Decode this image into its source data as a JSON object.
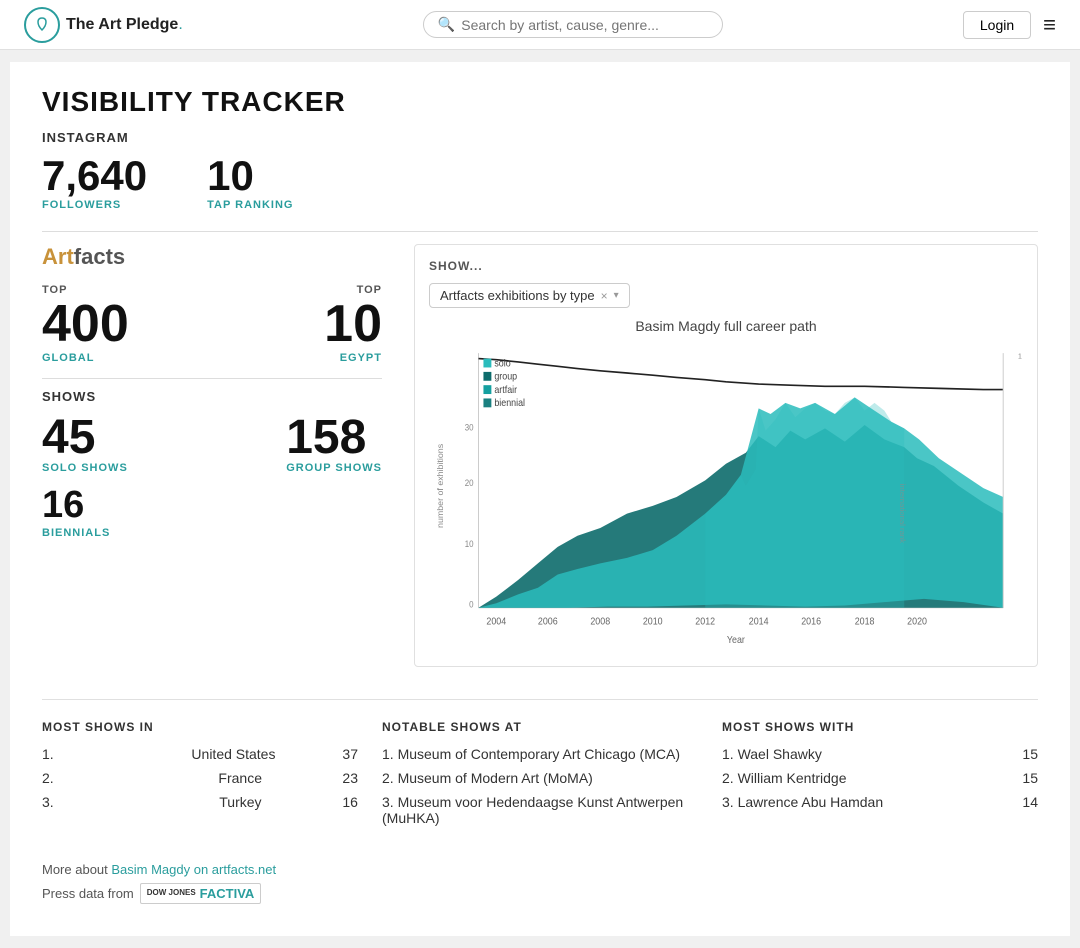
{
  "header": {
    "logo_text": "The Art Pledge",
    "logo_dot": ".",
    "search_placeholder": "Search by artist, cause, genre...",
    "login_label": "Login",
    "menu_icon": "≡"
  },
  "page": {
    "title": "VISIBILITY TRACKER"
  },
  "instagram": {
    "section_label": "INSTAGRAM",
    "followers_value": "7,640",
    "followers_label": "FOLLOWERS",
    "tap_ranking_value": "10",
    "tap_ranking_label": "TAP RANKING"
  },
  "artfacts": {
    "logo_art": "Art",
    "logo_facts": "facts",
    "top_label_left": "TOP",
    "top_label_right": "TOP",
    "rank_left": "400",
    "rank_left_label": "GLOBAL",
    "rank_right": "10",
    "rank_right_label": "EGYPT",
    "shows_header": "SHOWS",
    "solo_shows_value": "45",
    "solo_shows_label": "SOLO SHOWS",
    "group_shows_value": "158",
    "group_shows_label": "GROUP SHOWS",
    "biennials_value": "16",
    "biennials_label": "BIENNIALS"
  },
  "chart": {
    "show_label": "SHOW...",
    "dropdown_value": "Artfacts exhibitions by type",
    "title": "Basim Magdy full career path",
    "legend": [
      "solo",
      "group",
      "artfair",
      "biennial"
    ],
    "colors": [
      "#2abcbc",
      "#1a8080",
      "#15a0a0",
      "#0d6060"
    ],
    "x_axis_label": "Year",
    "years": [
      "2004",
      "2006",
      "2008",
      "2010",
      "2012",
      "2014",
      "2016",
      "2018",
      "2020"
    ]
  },
  "most_shows_in": {
    "title": "MOST SHOWS IN",
    "items": [
      {
        "rank": "1.",
        "name": "United States",
        "count": "37"
      },
      {
        "rank": "2.",
        "name": "France",
        "count": "23"
      },
      {
        "rank": "3.",
        "name": "Turkey",
        "count": "16"
      }
    ]
  },
  "notable_shows_at": {
    "title": "NOTABLE SHOWS AT",
    "items": [
      {
        "rank": "1.",
        "name": "Museum of Contemporary Art Chicago (MCA)",
        "count": ""
      },
      {
        "rank": "2.",
        "name": "Museum of Modern Art (MoMA)",
        "count": ""
      },
      {
        "rank": "3.",
        "name": "Museum voor Hedendaagse Kunst Antwerpen (MuHKA)",
        "count": ""
      }
    ]
  },
  "most_shows_with": {
    "title": "MOST SHOWS WITH",
    "items": [
      {
        "rank": "1.",
        "name": "Wael Shawky",
        "count": "15"
      },
      {
        "rank": "2.",
        "name": "William Kentridge",
        "count": "15"
      },
      {
        "rank": "3.",
        "name": "Lawrence Abu Hamdan",
        "count": "14"
      }
    ]
  },
  "footer": {
    "more_about_prefix": "More about ",
    "more_about_link": "Basim Magdy on artfacts.net",
    "press_data_label": "Press data from",
    "factiva_line1": "DOW JONES",
    "factiva_line2": "FACTIVA"
  }
}
